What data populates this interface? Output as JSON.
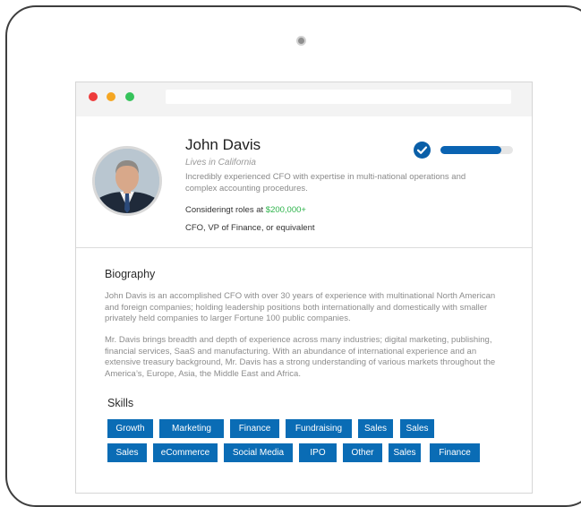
{
  "profile": {
    "name": "John Davis",
    "location": "Lives in California",
    "summary": "Incredibly experienced CFO with expertise in multi-national operations and complex accounting procedures.",
    "salary_prefix": "Consideringt roles at ",
    "salary_value": "$200,000+",
    "roles": "CFO, VP of Finance, or equivalent",
    "verified_icon": "check-circle-icon",
    "profile_completion": 0.84
  },
  "biography": {
    "title": "Biography",
    "paragraphs": [
      "John Davis is an accomplished CFO with over 30 years of experience with multinational North American and foreign companies; holding leadership positions both internationally and domestically with smaller privately held companies to larger Fortune 100 public companies.",
      "Mr. Davis brings breadth and depth of experience across many industries; digital marketing, publishing, financial services, SaaS and manufacturing.  With an abundance of international experience and an extensive treasury background, Mr. Davis has a strong understanding of various markets throughout the America’s, Europe, Asia, the Middle East and Africa."
    ]
  },
  "skills": {
    "title": "Skills",
    "items": [
      "Growth",
      "Marketing",
      "Finance",
      "Fundraising",
      "Sales",
      "Sales",
      "Sales",
      "eCommerce",
      "Social Media",
      "IPO",
      "Other",
      "Sales",
      "Finance"
    ]
  },
  "colors": {
    "accent": "#0a6cb5",
    "salary": "#2cb34a"
  }
}
